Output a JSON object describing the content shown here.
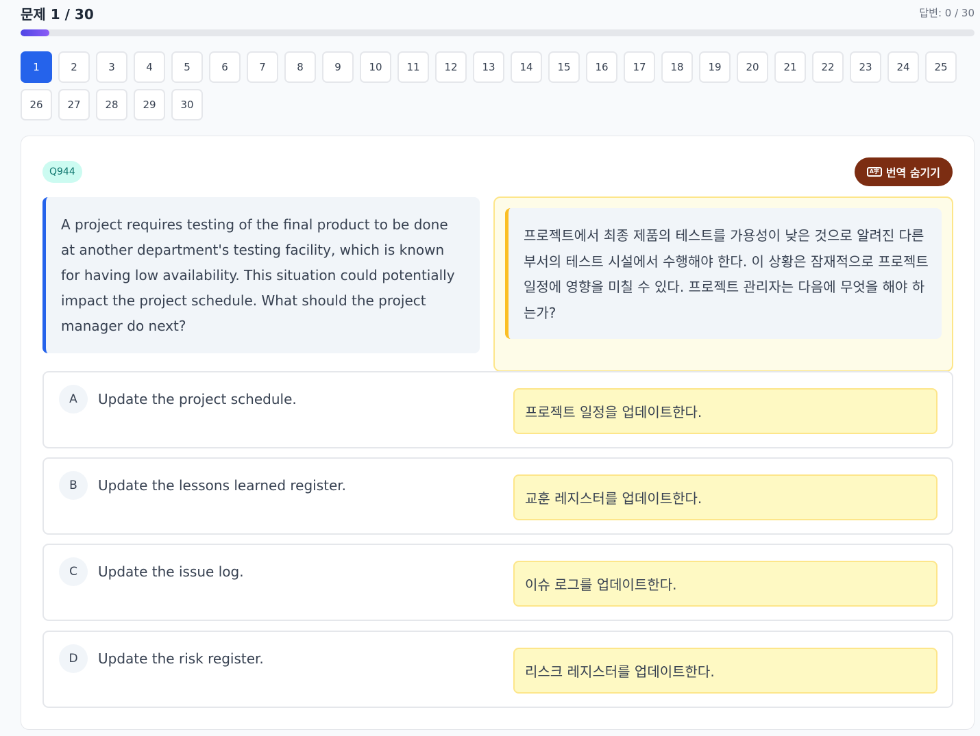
{
  "header": {
    "title": "문제 1 / 30",
    "answered": "답변: 0 / 30",
    "progress_fraction": 0.03
  },
  "nav": {
    "active": "1",
    "numbers": [
      "1",
      "2",
      "3",
      "4",
      "5",
      "6",
      "7",
      "8",
      "9",
      "10",
      "11",
      "12",
      "13",
      "14",
      "15",
      "16",
      "17",
      "18",
      "19",
      "20",
      "21",
      "22",
      "23",
      "24",
      "25",
      "26",
      "27",
      "28",
      "29",
      "30"
    ]
  },
  "question": {
    "id": "Q944",
    "translate_button": "번역 숨기기",
    "text_en": "A project requires testing of the final product to be done at another department's testing facility, which is known for having low availability. This situation could potentially impact the project schedule. What should the project manager do next?",
    "text_ko": "프로젝트에서 최종 제품의 테스트를 가용성이 낮은 것으로 알려진 다른 부서의 테스트 시설에서 수행해야 한다. 이 상황은 잠재적으로 프로젝트 일정에 영향을 미칠 수 있다. 프로젝트 관리자는 다음에 무엇을 해야 하는가?"
  },
  "options": [
    {
      "letter": "A",
      "text": "Update the project schedule.",
      "ko": "프로젝트 일정을 업데이트한다."
    },
    {
      "letter": "B",
      "text": "Update the lessons learned register.",
      "ko": "교훈 레지스터를 업데이트한다."
    },
    {
      "letter": "C",
      "text": "Update the issue log.",
      "ko": "이슈 로그를 업데이트한다."
    },
    {
      "letter": "D",
      "text": "Update the risk register.",
      "ko": "리스크 레지스터를 업데이트한다."
    }
  ]
}
